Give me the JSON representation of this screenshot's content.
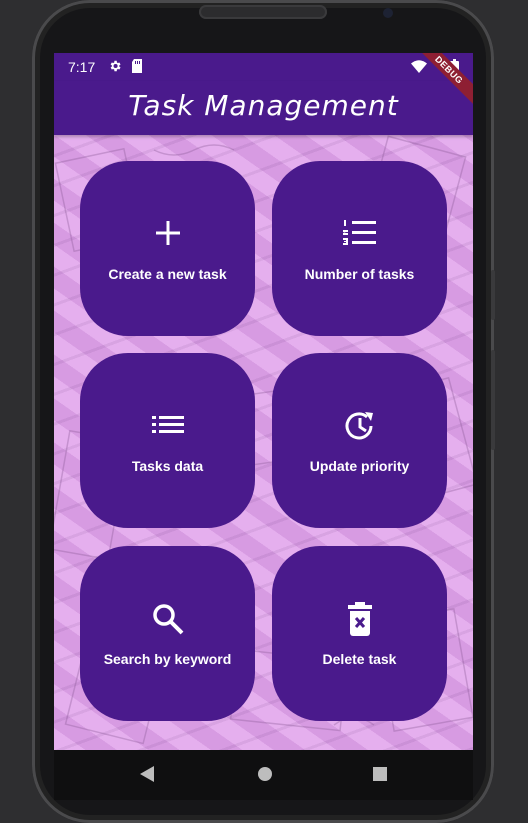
{
  "status_bar": {
    "time": "7:17",
    "left_icons": [
      "gear-icon",
      "sd-card-icon"
    ],
    "right_icons": [
      "wifi-icon",
      "battery-icon"
    ]
  },
  "app_bar": {
    "title": "Task Management",
    "debug_banner": "DEBUG"
  },
  "colors": {
    "primary": "#4a1a8c",
    "background_tint": "#e4a8ee",
    "tile_text": "#ffffff",
    "debug_banner": "#8e1f33"
  },
  "menu": {
    "tiles": [
      {
        "label": "Create a new task",
        "icon": "plus-icon"
      },
      {
        "label": "Number of tasks",
        "icon": "numbered-list-icon"
      },
      {
        "label": "Tasks data",
        "icon": "list-icon"
      },
      {
        "label": "Update priority",
        "icon": "restore-clock-icon"
      },
      {
        "label": "Search by keyword",
        "icon": "search-icon"
      },
      {
        "label": "Delete task",
        "icon": "trash-icon"
      }
    ]
  },
  "nav_bar": {
    "buttons": [
      "back-icon",
      "home-icon",
      "recents-icon"
    ]
  }
}
